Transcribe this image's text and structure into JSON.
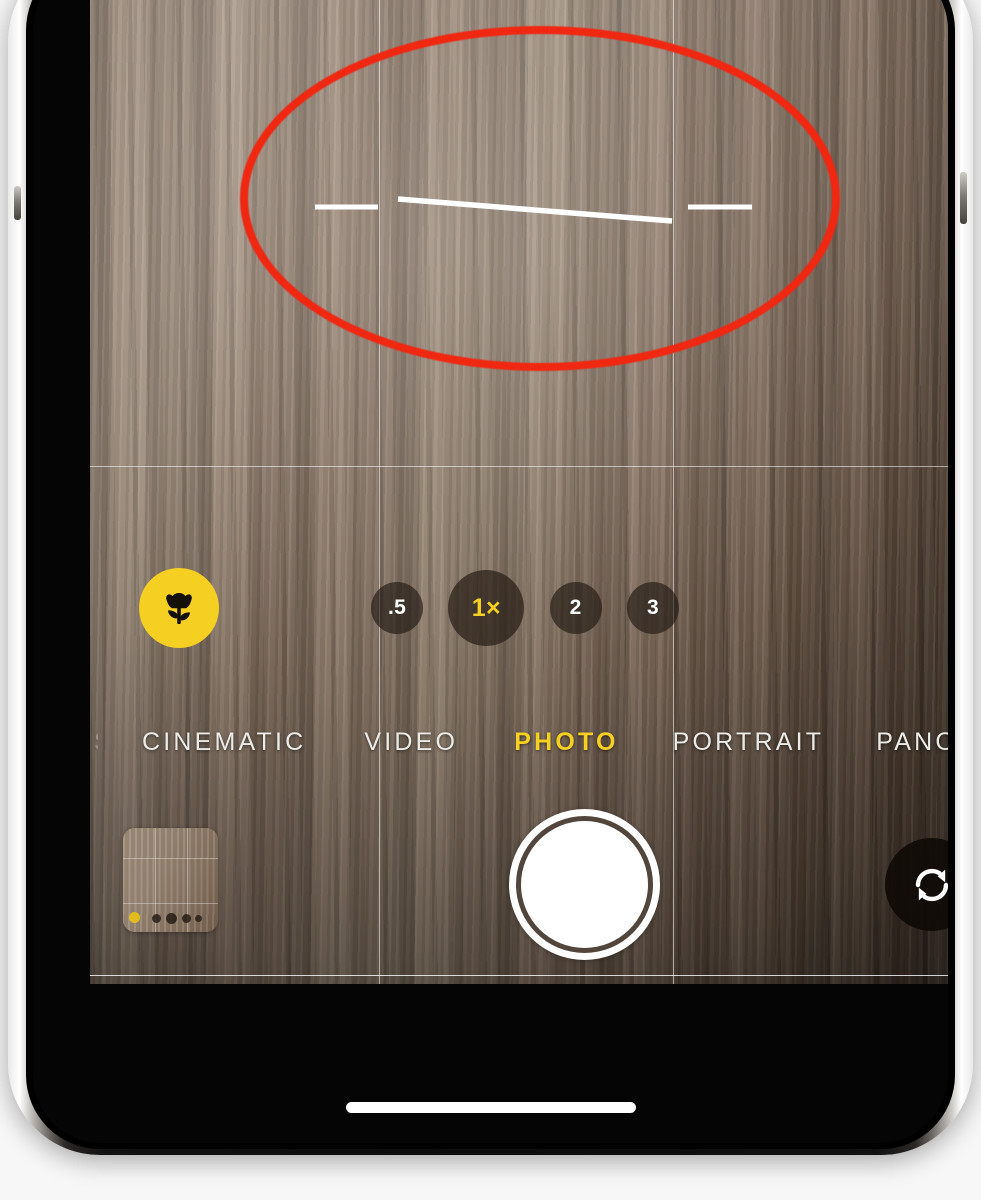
{
  "device": {
    "name": "iPhone",
    "orientation": "portrait",
    "buttons": {
      "volume_up": "volume-up",
      "power": "side-button"
    },
    "home_indicator": "home-indicator"
  },
  "camera": {
    "app": "Camera",
    "active_mode": "PHOTO",
    "grid_enabled": true,
    "level_indicator": {
      "visible": true,
      "icon": "horizon-level-icon",
      "center_line_tilt_degrees": 2.4,
      "aligned": false,
      "color": "#ffffff",
      "left_tick": "level-tick-left",
      "right_tick": "level-tick-right"
    },
    "macro": {
      "label": "macro-mode",
      "icon": "flower-icon",
      "active": true,
      "color": "#f5cf21"
    },
    "zoom": {
      "selected": "1×",
      "options": [
        {
          "label": ".5",
          "value": 0.5,
          "active": false
        },
        {
          "label": "1×",
          "value": 1,
          "active": true
        },
        {
          "label": "2",
          "value": 2,
          "active": false
        },
        {
          "label": "3",
          "value": 3,
          "active": false
        }
      ]
    },
    "modes": [
      {
        "label": "SLO-MO",
        "active": false,
        "partially_visible": true
      },
      {
        "label": "CINEMATIC",
        "active": false,
        "partially_visible": false
      },
      {
        "label": "VIDEO",
        "active": false,
        "partially_visible": false
      },
      {
        "label": "PHOTO",
        "active": true,
        "partially_visible": false
      },
      {
        "label": "PORTRAIT",
        "active": false,
        "partially_visible": false
      },
      {
        "label": "PANO",
        "active": false,
        "partially_visible": false
      }
    ],
    "controls": {
      "thumbnail": "photo-library-thumbnail",
      "shutter": "shutter-button",
      "flip": "camera-flip-button",
      "flip_icon": "rotate-arrows-icon"
    },
    "subject": "wood surface"
  },
  "annotation": {
    "shape": "ellipse",
    "color": "#f02711",
    "stroke_width": 8,
    "highlights": "level-indicator"
  },
  "colors": {
    "accent_yellow": "#f5cf21",
    "annotation_red": "#f02711",
    "wood_light": "#9d8a78",
    "wood_dark": "#4d3c2f",
    "chrome_white": "#ffffff",
    "bezel_black": "#000000"
  }
}
